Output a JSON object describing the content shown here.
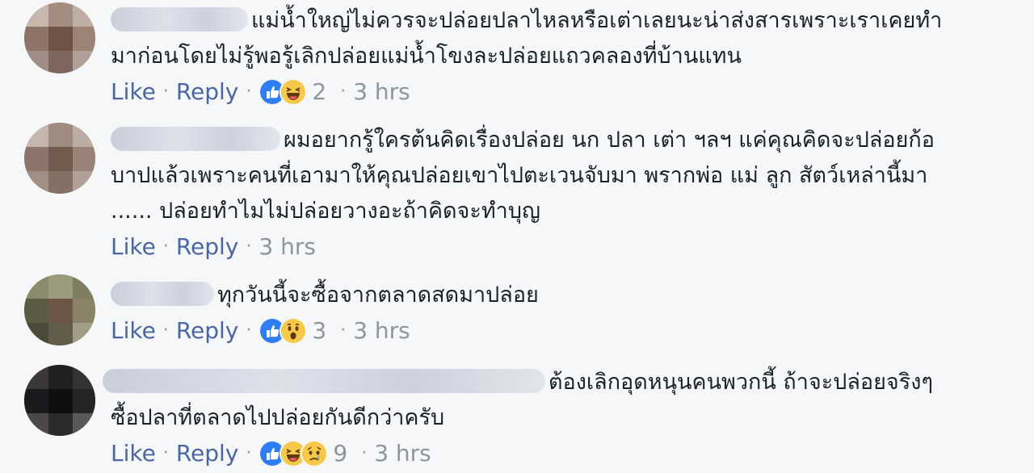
{
  "comments": [
    {
      "text": "แม่น้ำใหญ่ไม่ควรจะปล่อยปลาไหลหรือเต่าเลยนะน่าส่งสารเพราะเราเคยทำมาก่อนโดยไม่รู้พอรู้เลิกปล่อยแม่น้ำโขงละปล่อยแถวคลองที่บ้านแทน",
      "line1": "แม่น้ำใหญ่ไม่ควรจะปล่อยปลาไหลหรือเต่าเลยนะน่าส่งสารเพราะเราเคยทำ",
      "line2": "มาก่อนโดยไม่รู้พอรู้เลิกปล่อยแม่น้ำโขงละปล่อยแถวคลองที่บ้านแทน",
      "like_label": "Like",
      "reply_label": "Reply",
      "reaction_count": "2",
      "time": "3 hrs",
      "reactions": [
        "like-icon",
        "haha-icon"
      ]
    },
    {
      "line1": "ผมอยากรู้ใครต้นคิดเรื่องปล่อย นก ปลา เต่า ฯลฯ แค่คุณคิดจะปล่อยก้อ",
      "line2": "บาปแล้วเพราะคนที่เอามาให้คุณปล่อยเขาไปตะเวนจับมา พรากพ่อ แม่ ลูก สัตว์เหล่านี้มา",
      "line3": "...... ปล่อยทำไมไม่ปล่อยวางอะถ้าคิดจะทำบุญ",
      "like_label": "Like",
      "reply_label": "Reply",
      "time": "3 hrs",
      "reactions": []
    },
    {
      "line1": "ทุกวันนี้จะซื้อจากตลาดสดมาปล่อย",
      "like_label": "Like",
      "reply_label": "Reply",
      "reaction_count": "3",
      "time": "3 hrs",
      "reactions": [
        "like-icon",
        "wow-icon"
      ]
    },
    {
      "line1": "ต้องเลิกอุดหนุนคนพวกนี้ ถ้าจะปล่อยจริงๆ",
      "line2": "ซื้อปลาที่ตลาดไปปล่อยกันดีกว่าครับ",
      "like_label": "Like",
      "reply_label": "Reply",
      "reaction_count": "9",
      "time": "3 hrs",
      "reactions": [
        "like-icon",
        "haha-icon",
        "sad-icon"
      ]
    }
  ],
  "colors": {
    "link": "#4b67a1",
    "meta": "#90949c",
    "like": "#2e7df6",
    "emoji": "#f7c84a"
  }
}
